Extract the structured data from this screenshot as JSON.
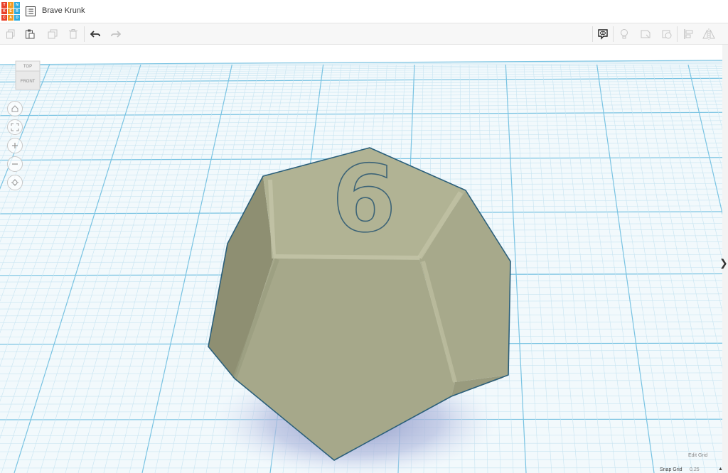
{
  "app": {
    "logo_letters": [
      "T",
      "I",
      "N",
      "K",
      "E",
      "R",
      "C",
      "A",
      "D"
    ],
    "logo_colors": [
      "#e8412a",
      "#f49a1f",
      "#2eaadc",
      "#e8412a",
      "#f49a1f",
      "#2eaadc",
      "#e8412a",
      "#f49a1f",
      "#2eaadc"
    ],
    "title": "Brave Krunk"
  },
  "toolbar": {
    "left_icons": [
      "copy-icon",
      "paste-icon",
      "duplicate-icon",
      "delete-icon",
      "undo-icon",
      "redo-icon"
    ],
    "right_icons": [
      "notes-visibility-icon",
      "light-bulb-icon",
      "shape-icon",
      "hole-icon",
      "align-icon",
      "mirror-icon"
    ]
  },
  "viewcube": {
    "top_label": "TOP",
    "front_label": "FRONT"
  },
  "nav_controls": [
    "home-view-icon",
    "fit-view-icon",
    "zoom-in-icon",
    "zoom-out-icon",
    "orthographic-icon"
  ],
  "grid": {
    "edit_label": "Edit Grid",
    "snap_label": "Snap Grid",
    "snap_value": "0.25",
    "snap_arrow": "▲"
  },
  "model": {
    "engraved_number": "6",
    "color": "#a9ab8f"
  },
  "colors": {
    "grid_minor": "#c7e4f1",
    "grid_major": "#79c3e2",
    "accent": "#2b5f7a"
  },
  "side_toggle": "❯"
}
